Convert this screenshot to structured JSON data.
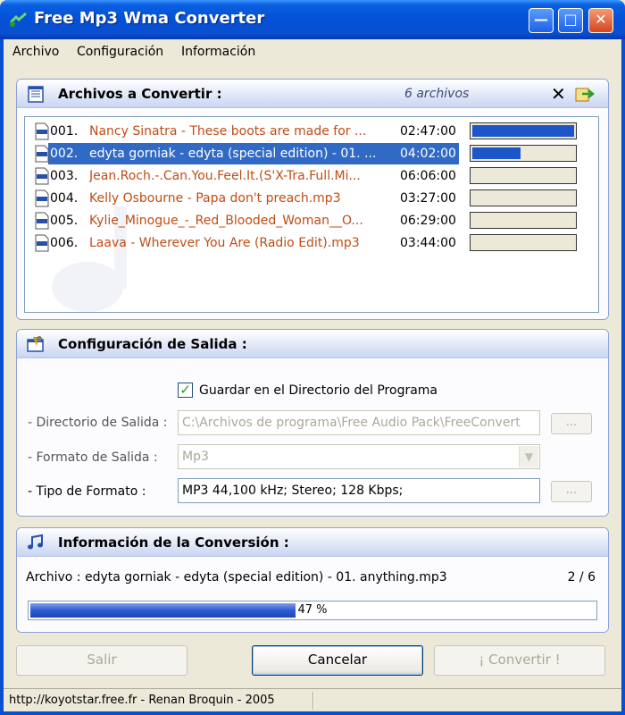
{
  "window": {
    "title": "Free Mp3 Wma Converter",
    "min_glyph": "—",
    "max_glyph": "□",
    "close_glyph": "✕"
  },
  "menu": [
    "Archivo",
    "Configuración",
    "Información"
  ],
  "files_panel": {
    "title": "Archivos a Convertir :",
    "count_label": "6 archivos",
    "clear_glyph": "✕",
    "files": [
      {
        "num": "001.",
        "name": "Nancy Sinatra - These boots are made for ...",
        "duration": "02:47:00",
        "progress": 1.0
      },
      {
        "num": "002.",
        "name": "edyta gorniak - edyta (special edition) - 01. ...",
        "duration": "04:02:00",
        "progress": 0.47
      },
      {
        "num": "003.",
        "name": "Jean.Roch.-.Can.You.Feel.It.(S'X-Tra.Full.Mi...",
        "duration": "06:06:00",
        "progress": 0
      },
      {
        "num": "004.",
        "name": "Kelly Osbourne - Papa don't preach.mp3",
        "duration": "03:27:00",
        "progress": 0
      },
      {
        "num": "005.",
        "name": "Kylie_Minogue_-_Red_Blooded_Woman__O...",
        "duration": "06:29:00",
        "progress": 0
      },
      {
        "num": "006.",
        "name": "Laava - Wherever You Are (Radio Edit).mp3",
        "duration": "03:44:00",
        "progress": 0
      }
    ]
  },
  "config_panel": {
    "title": "Configuración de Salida :",
    "save_in_program_dir_label": "Guardar en el Directorio del Programa",
    "save_in_program_dir_checked": true,
    "check_glyph": "✓",
    "output_dir_label": "- Directorio de Salida :",
    "output_dir_value": "C:\\Archivos de programa\\Free Audio Pack\\FreeConvert",
    "output_format_label": "- Formato de Salida :",
    "output_format_value": "Mp3",
    "format_type_label": "- Tipo de Formato :",
    "format_type_value": "MP3 44,100 kHz; Stereo;  128 Kbps;",
    "browse_label": "...",
    "dropdown_glyph": "▼"
  },
  "info_panel": {
    "title": "Información de la Conversión :",
    "file_label": "Archivo : edyta gorniak - edyta (special edition) - 01. anything.mp3",
    "counter": "2 / 6",
    "progress_percent": 47,
    "progress_text": "47 %"
  },
  "buttons": {
    "exit": "Salir",
    "cancel": "Cancelar",
    "convert": "¡ Convertir !"
  },
  "status_bar": {
    "text": "http://koyotstar.free.fr - Renan Broquin - 2005"
  },
  "colors": {
    "titlebar": "#0451d6",
    "selection": "#316ac5",
    "file_name_text": "#c04c14",
    "progress_fill": "#1c56c8"
  }
}
